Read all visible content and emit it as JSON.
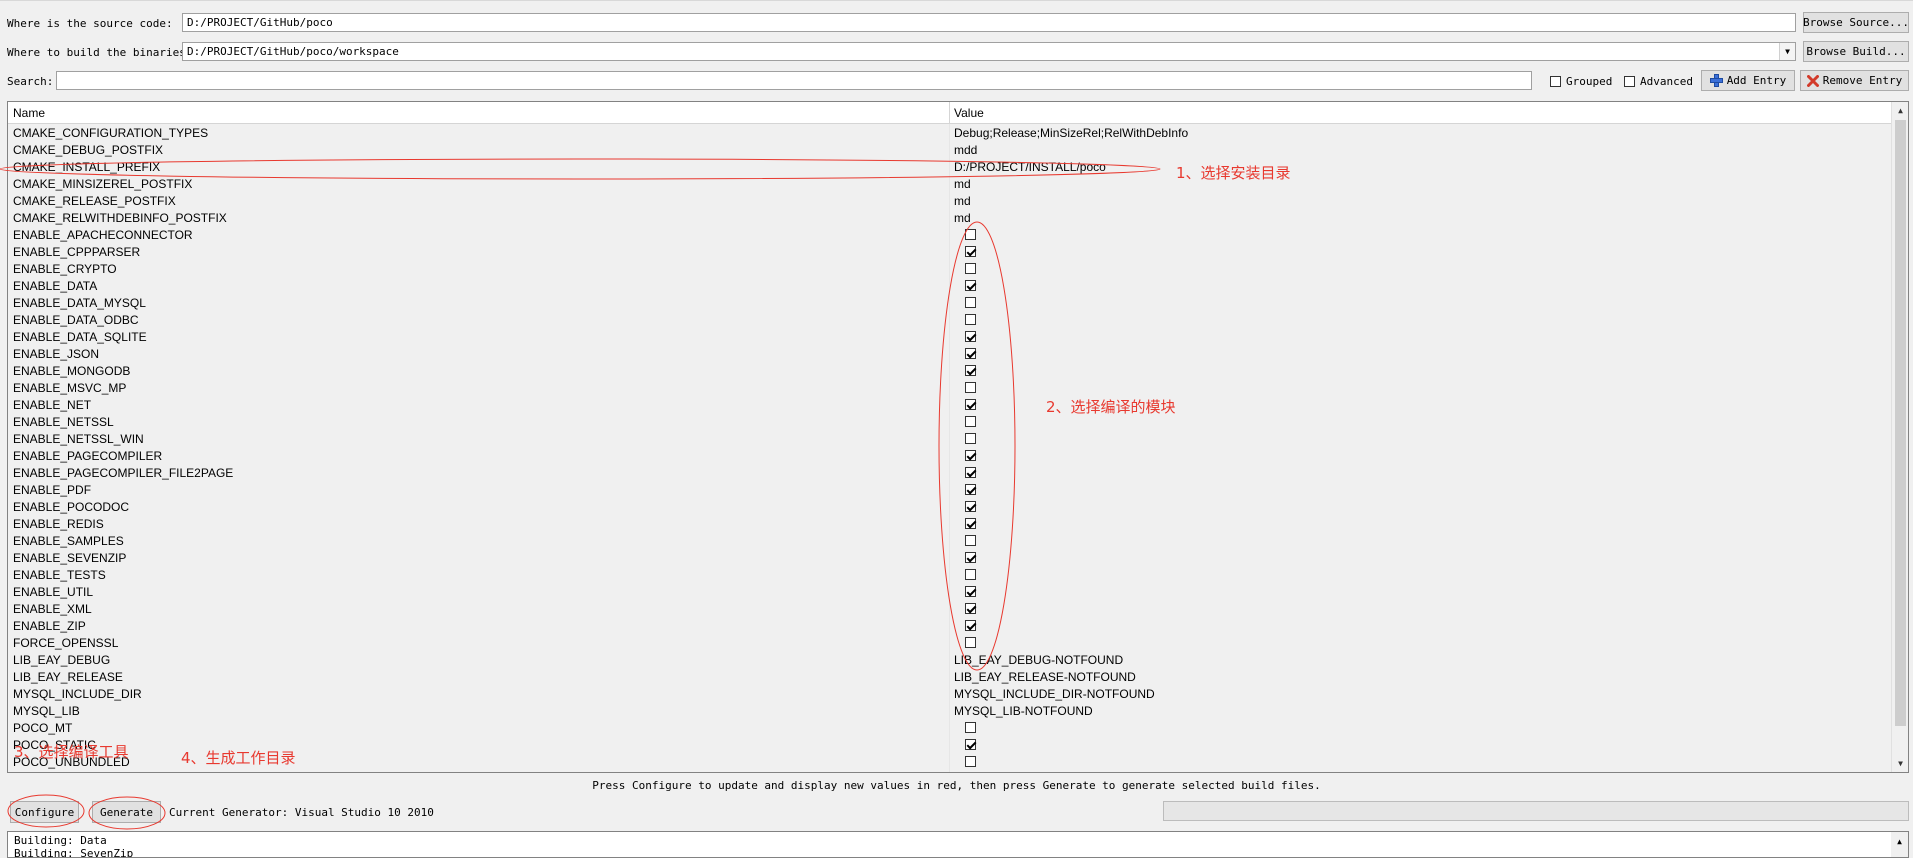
{
  "header": {
    "source_label": "Where is the source code:",
    "source_value": "D:/PROJECT/GitHub/poco",
    "browse_source": "Browse Source...",
    "build_label": "Where to build the binaries:",
    "build_value": "D:/PROJECT/GitHub/poco/workspace",
    "browse_build": "Browse Build...",
    "search_label": "Search:",
    "search_value": "",
    "grouped_label": "Grouped",
    "advanced_label": "Advanced",
    "add_entry": "Add Entry",
    "remove_entry": "Remove Entry"
  },
  "table": {
    "col_name": "Name",
    "col_value": "Value",
    "rows": [
      {
        "name": "CMAKE_CONFIGURATION_TYPES",
        "value": "Debug;Release;MinSizeRel;RelWithDebInfo"
      },
      {
        "name": "CMAKE_DEBUG_POSTFIX",
        "value": "mdd"
      },
      {
        "name": "CMAKE_INSTALL_PREFIX",
        "value": "D:/PROJECT/INSTALL/poco"
      },
      {
        "name": "CMAKE_MINSIZEREL_POSTFIX",
        "value": "md"
      },
      {
        "name": "CMAKE_RELEASE_POSTFIX",
        "value": "md"
      },
      {
        "name": "CMAKE_RELWITHDEBINFO_POSTFIX",
        "value": "md"
      },
      {
        "name": "ENABLE_APACHECONNECTOR",
        "checked": false
      },
      {
        "name": "ENABLE_CPPPARSER",
        "checked": true
      },
      {
        "name": "ENABLE_CRYPTO",
        "checked": false
      },
      {
        "name": "ENABLE_DATA",
        "checked": true
      },
      {
        "name": "ENABLE_DATA_MYSQL",
        "checked": false
      },
      {
        "name": "ENABLE_DATA_ODBC",
        "checked": false
      },
      {
        "name": "ENABLE_DATA_SQLITE",
        "checked": true
      },
      {
        "name": "ENABLE_JSON",
        "checked": true
      },
      {
        "name": "ENABLE_MONGODB",
        "checked": true
      },
      {
        "name": "ENABLE_MSVC_MP",
        "checked": false
      },
      {
        "name": "ENABLE_NET",
        "checked": true
      },
      {
        "name": "ENABLE_NETSSL",
        "checked": false
      },
      {
        "name": "ENABLE_NETSSL_WIN",
        "checked": false
      },
      {
        "name": "ENABLE_PAGECOMPILER",
        "checked": true
      },
      {
        "name": "ENABLE_PAGECOMPILER_FILE2PAGE",
        "checked": true
      },
      {
        "name": "ENABLE_PDF",
        "checked": true
      },
      {
        "name": "ENABLE_POCODOC",
        "checked": true
      },
      {
        "name": "ENABLE_REDIS",
        "checked": true
      },
      {
        "name": "ENABLE_SAMPLES",
        "checked": false
      },
      {
        "name": "ENABLE_SEVENZIP",
        "checked": true
      },
      {
        "name": "ENABLE_TESTS",
        "checked": false
      },
      {
        "name": "ENABLE_UTIL",
        "checked": true
      },
      {
        "name": "ENABLE_XML",
        "checked": true
      },
      {
        "name": "ENABLE_ZIP",
        "checked": true
      },
      {
        "name": "FORCE_OPENSSL",
        "checked": false
      },
      {
        "name": "LIB_EAY_DEBUG",
        "value": "LIB_EAY_DEBUG-NOTFOUND"
      },
      {
        "name": "LIB_EAY_RELEASE",
        "value": "LIB_EAY_RELEASE-NOTFOUND"
      },
      {
        "name": "MYSQL_INCLUDE_DIR",
        "value": "MYSQL_INCLUDE_DIR-NOTFOUND"
      },
      {
        "name": "MYSQL_LIB",
        "value": "MYSQL_LIB-NOTFOUND"
      },
      {
        "name": "POCO_MT",
        "checked": false
      },
      {
        "name": "POCO_STATIC",
        "checked": true
      },
      {
        "name": "POCO_UNBUNDLED",
        "checked": false
      }
    ]
  },
  "footer": {
    "hint": "Press Configure to update and display new values in red, then press Generate to generate selected build files.",
    "configure": "Configure",
    "generate": "Generate",
    "current_generator": "Current Generator: Visual Studio 10 2010"
  },
  "log": {
    "lines": [
      "Building: Data",
      "Building: SevenZip"
    ]
  },
  "annotations": {
    "step1": "1、选择安装目录",
    "step2": "2、选择编译的模块",
    "step3": "3、选择编译工具",
    "step4": "4、生成工作目录",
    "color": "#e8392f"
  }
}
